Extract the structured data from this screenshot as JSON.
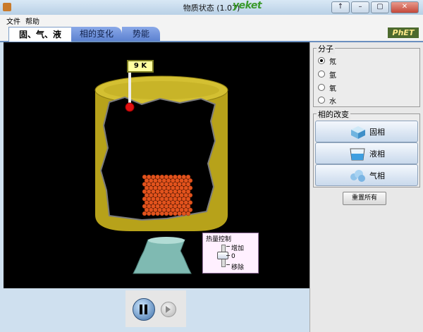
{
  "window": {
    "title": "物质状态 (1.07)",
    "logo_text": "yeket",
    "buttons": [
      "↑",
      "–",
      "▢",
      "✕"
    ]
  },
  "menu": {
    "items": [
      "文件",
      "帮助"
    ]
  },
  "tabs": [
    {
      "label": "固、气、液",
      "active": true
    },
    {
      "label": "相的变化",
      "active": false
    },
    {
      "label": "势能",
      "active": false
    }
  ],
  "brand": {
    "logo": "PhET"
  },
  "simulation": {
    "thermometer_reading": "9 K",
    "heater": {
      "title": "热量控制",
      "add": "增加",
      "zero": "0",
      "remove": "移除",
      "level": 0
    }
  },
  "controls": {
    "pause_icon": "pause-icon",
    "step_icon": "step-icon"
  },
  "molecules": {
    "legend": "分子",
    "options": [
      "氖",
      "氩",
      "氧",
      "水"
    ],
    "selected": "氖"
  },
  "phase_change": {
    "legend": "相的改变",
    "buttons": [
      "固相",
      "液相",
      "气相"
    ]
  },
  "reset_label": "重置所有",
  "colors": {
    "container": "#bfae1e",
    "particle": "#e2531d",
    "canvas": "#000000",
    "bulb": "#e01010"
  }
}
